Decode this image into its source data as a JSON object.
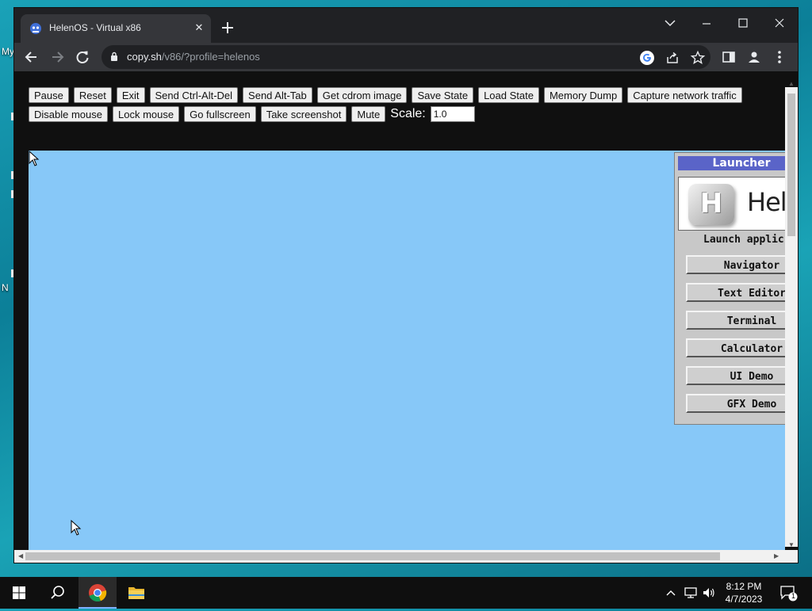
{
  "desktop": {
    "fragment_1": "My",
    "fragment_2": "N"
  },
  "browser": {
    "tab_title": "HelenOS - Virtual x86",
    "url_host": "copy.sh",
    "url_path": "/v86/?profile=helenos"
  },
  "emulator": {
    "buttons_row1": [
      "Pause",
      "Reset",
      "Exit",
      "Send Ctrl-Alt-Del",
      "Send Alt-Tab",
      "Get cdrom image",
      "Save State",
      "Load State",
      "Memory Dump",
      "Capture network traffic"
    ],
    "buttons_row2": [
      "Disable mouse",
      "Lock mouse",
      "Go fullscreen",
      "Take screenshot",
      "Mute"
    ],
    "scale_label": "Scale:",
    "scale_value": "1.0"
  },
  "launcher": {
    "title": "Launcher",
    "logo_letter": "H",
    "logo_text": "Hele",
    "caption": "Launch applic",
    "apps": [
      "Navigator",
      "Text Editor",
      "Terminal",
      "Calculator",
      "UI Demo",
      "GFX Demo"
    ]
  },
  "taskbar": {
    "time": "8:12 PM",
    "date": "4/7/2023",
    "notification_count": "1"
  },
  "colors": {
    "vm_background": "#87c8f8",
    "launcher_titlebar": "#5a64c8",
    "browser_dark": "#202124"
  },
  "icons": [
    "windows-start-icon",
    "search-icon",
    "chrome-icon",
    "file-explorer-icon",
    "lock-icon",
    "google-icon",
    "share-icon",
    "star-icon",
    "side-panel-icon",
    "profile-icon",
    "menu-icon"
  ]
}
